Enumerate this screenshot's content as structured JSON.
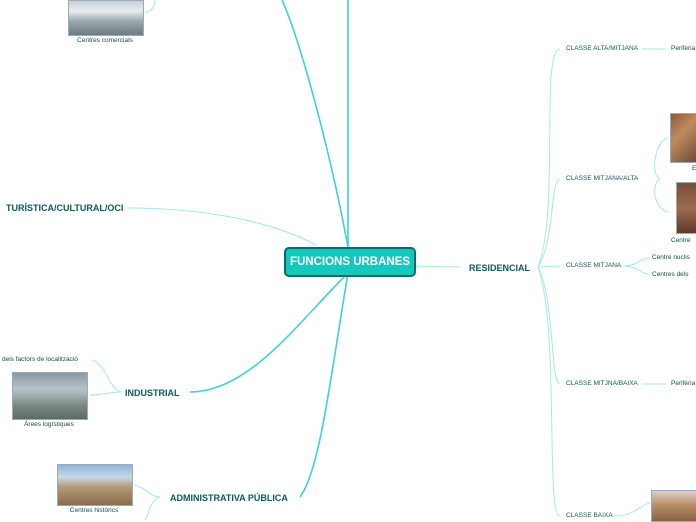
{
  "root": "FUNCIONS URBANES",
  "main": {
    "turistica": "TURÍSTICA/CULTURAL/OCI",
    "industrial": "INDUSTRIAL",
    "administrativa": "ADMINISTRATIVA PÚBLICA",
    "residencial": "RESIDENCIAL"
  },
  "captions": {
    "comercials": "Centres comercials",
    "logistiques": "Àrees logístiques",
    "historics": "Centres històrics",
    "factors": "dels factors de localització"
  },
  "classes": {
    "alta_mitjana": "CLASSE ALTA/MITJANA",
    "mitjana_alta": "CLASSE MITJANA/ALTA",
    "mitjana": "CLASSE MITJANA",
    "mitjana_baixa": "CLASSE MITJNA/BAIXA",
    "baixa": "CLASSE BAIXA"
  },
  "leaves": {
    "periferia1": "Perifèria",
    "centre_nucli": "Centre nuclis",
    "centres_dels": "Centres dels",
    "centre_p": "Centre",
    "eixample_b": "E",
    "periferia2": "Perifèria"
  }
}
